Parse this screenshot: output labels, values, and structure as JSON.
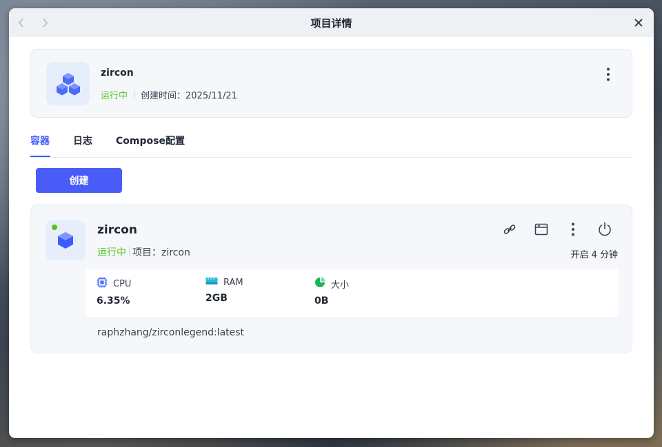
{
  "window": {
    "title": "项目详情",
    "nav_icons": [
      "chevron-left-icon",
      "chevron-right-icon"
    ],
    "close_icon": "close-icon"
  },
  "project": {
    "name": "zircon",
    "status": "运行中",
    "created": "创建时间：2025/11/21",
    "icon": "cubes-icon"
  },
  "tabs": [
    {
      "label": "容器",
      "active": true
    },
    {
      "label": "日志",
      "active": false
    },
    {
      "label": "Compose配置",
      "active": false
    }
  ],
  "create_button": "创建",
  "container": {
    "name": "zircon",
    "status": "运行中",
    "project": "项目：zircon",
    "uptime": "开启 4 分钟",
    "image": "raphzhang/zirconlegend:latest",
    "actions": [
      "link-icon",
      "terminal-window-icon",
      "more-vertical-icon",
      "power-icon"
    ],
    "stats": [
      {
        "label": "CPU",
        "value": "6.35%",
        "icon": "cpu-icon"
      },
      {
        "label": "RAM",
        "value": "2GB",
        "icon": "ram-icon"
      },
      {
        "label": "大小",
        "value": "0B",
        "icon": "pie-chart-icon"
      }
    ]
  },
  "colors": {
    "accent": "#4a5cf7",
    "tab_active": "#3d5afe",
    "status_running": "#52c41a"
  }
}
